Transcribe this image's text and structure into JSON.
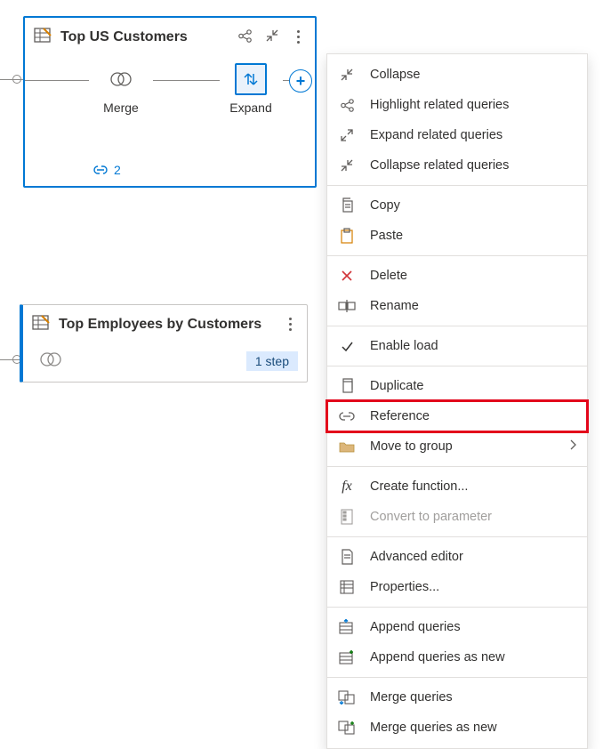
{
  "card1": {
    "title": "Top US Customers",
    "steps": {
      "merge": "Merge",
      "expand": "Expand"
    },
    "ref_count": "2"
  },
  "card2": {
    "title": "Top Employees by Customers",
    "step_badge": "1 step"
  },
  "menu": {
    "collapse": "Collapse",
    "highlight_related": "Highlight related queries",
    "expand_related": "Expand related queries",
    "collapse_related": "Collapse related queries",
    "copy": "Copy",
    "paste": "Paste",
    "delete": "Delete",
    "rename": "Rename",
    "enable_load": "Enable load",
    "duplicate": "Duplicate",
    "reference": "Reference",
    "move_to_group": "Move to group",
    "create_function": "Create function...",
    "convert_to_parameter": "Convert to parameter",
    "advanced_editor": "Advanced editor",
    "properties": "Properties...",
    "append_queries": "Append queries",
    "append_queries_new": "Append queries as new",
    "merge_queries": "Merge queries",
    "merge_queries_new": "Merge queries as new"
  }
}
